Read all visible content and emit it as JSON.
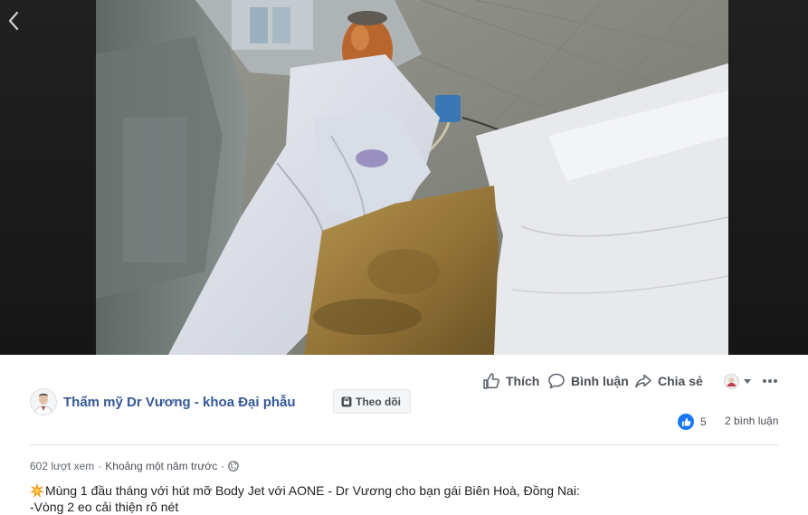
{
  "viewer": {
    "back_icon": "chevron-left-icon"
  },
  "actions": {
    "like_label": "Thích",
    "comment_label": "Bình luận",
    "share_label": "Chia sẻ"
  },
  "page": {
    "name": "Thẩm mỹ Dr Vương - khoa Đại phẫu",
    "follow_label": "Theo dõi"
  },
  "stats": {
    "reaction_count": "5",
    "comments_label": "2 bình luận"
  },
  "meta": {
    "views": "602 lượt xem",
    "separator": "·",
    "time": "Khoảng một năm trước",
    "privacy_icon": "globe-icon"
  },
  "post": {
    "line1": "Mùng 1 đầu tháng với hút mỡ Body Jet với AONE - Dr Vương cho bạn gái Biên Hoà, Đồng Nai:",
    "line2": "-Vòng 2 eo cải thiện rõ nét"
  },
  "colors": {
    "link": "#365899",
    "like_blue": "#1877f2",
    "text": "#4b4f56"
  }
}
